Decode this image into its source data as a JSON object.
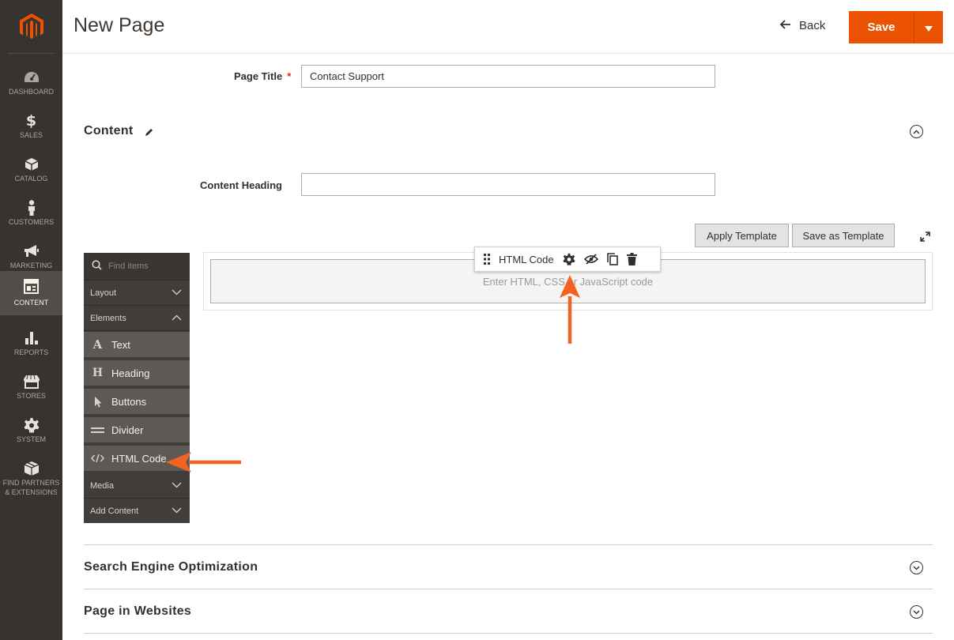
{
  "nav": {
    "items": [
      {
        "label": "DASHBOARD",
        "icon": "dashboard-icon"
      },
      {
        "label": "SALES",
        "icon": "dollar-icon"
      },
      {
        "label": "CATALOG",
        "icon": "cube-icon"
      },
      {
        "label": "CUSTOMERS",
        "icon": "person-icon"
      },
      {
        "label": "MARKETING",
        "icon": "megaphone-icon"
      },
      {
        "label": "CONTENT",
        "icon": "layout-icon"
      },
      {
        "label": "REPORTS",
        "icon": "bar-chart-icon"
      },
      {
        "label": "STORES",
        "icon": "storefront-icon"
      },
      {
        "label": "SYSTEM",
        "icon": "gear-icon"
      },
      {
        "label": "FIND PARTNERS",
        "label2": "& EXTENSIONS",
        "icon": "box-icon"
      }
    ],
    "active": "CONTENT"
  },
  "header": {
    "title": "New Page",
    "back_label": "Back",
    "save_label": "Save"
  },
  "form": {
    "page_title_label": "Page Title",
    "page_title_value": "Contact Support",
    "content_heading_label": "Content Heading",
    "content_heading_value": ""
  },
  "content_section": {
    "title": "Content",
    "apply_template": "Apply Template",
    "save_as_template": "Save as Template"
  },
  "panel": {
    "search_placeholder": "Find items",
    "groups": {
      "layout": "Layout",
      "elements": "Elements",
      "media": "Media",
      "add_content": "Add Content"
    },
    "elements": [
      {
        "label": "Text",
        "icon": "text-icon"
      },
      {
        "label": "Heading",
        "icon": "heading-icon"
      },
      {
        "label": "Buttons",
        "icon": "cursor-icon"
      },
      {
        "label": "Divider",
        "icon": "divider-icon"
      },
      {
        "label": "HTML Code",
        "icon": "code-icon"
      }
    ]
  },
  "stage": {
    "toolbar_label": "HTML Code",
    "placeholder": "Enter HTML, CSS or JavaScript code"
  },
  "sections": {
    "seo": "Search Engine Optimization",
    "websites": "Page in Websites"
  },
  "colors": {
    "accent": "#eb5202",
    "annotation_arrow": "#f26322",
    "nav_bg": "#373330"
  }
}
